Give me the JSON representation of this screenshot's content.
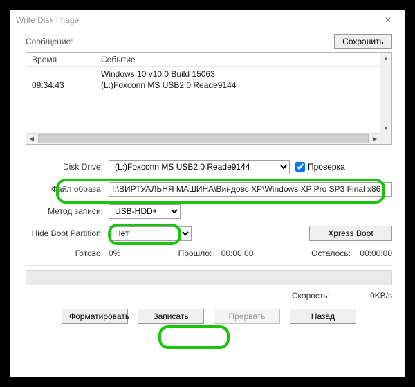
{
  "window": {
    "title": "Write Disk Image"
  },
  "msg": {
    "label": "Сообщение:",
    "save": "Сохранить"
  },
  "log": {
    "headers": {
      "time": "Время",
      "event": "Событие"
    },
    "rows": [
      {
        "time": "",
        "event": "Windows 10 v10.0 Build 15063"
      },
      {
        "time": "09:34:43",
        "event": "(L:)Foxconn MS  USB2.0 Reade9144"
      }
    ]
  },
  "fields": {
    "disk_drive": {
      "label": "Disk Drive:",
      "value": "(L:)Foxconn MS  USB2.0 Reade9144"
    },
    "verify": {
      "label": "Проверка",
      "checked": true
    },
    "image_file": {
      "label": "Файл образа:",
      "value": "I:\\ВИРТУАЛЬНЯ МАШИНА\\Виндовс XP\\Windows XP Pro SP3 Final x86"
    },
    "write_method": {
      "label": "Метод записи:",
      "value": "USB-HDD+"
    },
    "hide_boot": {
      "label": "Hide Boot Partition:",
      "value": "Нет"
    },
    "xpress": "Xpress Boot"
  },
  "progress": {
    "ready_label": "Готово:",
    "percent": "0%",
    "elapsed_label": "Прошло:",
    "elapsed_value": "00:00:00",
    "remain_label": "Осталось:",
    "remain_value": "00:00:00",
    "speed_label": "Скорость:",
    "speed_value": "0KB/s"
  },
  "buttons": {
    "format": "Форматировать",
    "write": "Записать",
    "abort": "Прервать",
    "back": "Назад"
  }
}
